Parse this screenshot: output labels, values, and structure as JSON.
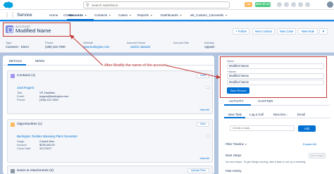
{
  "header": {
    "search_placeholder": "Search Salesforce",
    "badge_1": "Lex",
    "badge_2": "SDFC RT AC",
    "colors": {
      "badge_1": "#ffb75d",
      "badge_2": "#4bca81"
    }
  },
  "nav": {
    "app_name": "Service",
    "items": [
      "Home",
      "Chatter",
      "Accounts",
      "Contacts",
      "Cases",
      "Reports",
      "Dashboards",
      "wk_Custom_Carousels"
    ],
    "active": "Accounts"
  },
  "record": {
    "type_label": "ACCOUNT",
    "name": "Modified Name",
    "buttons": {
      "follow": "+ Follow",
      "new_contact": "New Contact",
      "new_case": "New Case",
      "new_note": "New Note"
    },
    "fields": [
      {
        "label": "Type",
        "value": "Customer - Direct"
      },
      {
        "label": "Phone",
        "value": "(336) 222-7000"
      },
      {
        "label": "Website",
        "value": "www.burlington.com"
      },
      {
        "label": "Account Owner",
        "value": "Sachin Jaiswal"
      },
      {
        "label": "Account Site",
        "value": ""
      },
      {
        "label": "Industry",
        "value": "Apparel"
      }
    ]
  },
  "tabs": {
    "details": "DETAILS",
    "news": "NEWS"
  },
  "contacts_card": {
    "title": "Contacts (1)",
    "new_label": "New",
    "contact_name": "Jack Rogers",
    "rows": [
      {
        "k": "Title:",
        "v": "VP, Facilities"
      },
      {
        "k": "Email:",
        "v": "jrogers@burlington.com"
      },
      {
        "k": "Phone:",
        "v": "(336) 222-7000"
      }
    ],
    "view_all": "View All"
  },
  "opportunities_card": {
    "title": "Opportunities (1)",
    "new_label": "New",
    "opp_name": "Burlington Textiles Weaving Plant Generator",
    "rows": [
      {
        "k": "Stage:",
        "v": "Closed Won"
      },
      {
        "k": "Amount:",
        "v": "$235,000.00"
      },
      {
        "k": "Close Date:",
        "v": "4/17/2017"
      }
    ],
    "view_all": "View All"
  },
  "notes_card": {
    "title": "Notes & Attachments (0)",
    "upload_label": "Upload Files"
  },
  "quick_form": {
    "name_label": "Name",
    "name_value": "Modified Name",
    "name_label_2": "Name",
    "name_value_2": "Modified Name",
    "name_value_3": "Modified Name",
    "save_label": "Save Record"
  },
  "activity": {
    "tab_activity": "ACTIVITY",
    "tab_chatter": "CHATTER",
    "sub_tabs": [
      "New Task",
      "Log a Call",
      "New Eve...",
      "Email"
    ],
    "task_placeholder": "Create a task...",
    "add_label": "Add",
    "filter_label": "Filter Timeline",
    "expand_label": "Expand All",
    "next_steps": "Next Steps",
    "more_steps": "More Steps",
    "no_steps": "No next steps. To get things moving, add a task or set up a meeting.",
    "past_activity": "Past Activity"
  },
  "annotation": {
    "text": "After Modify the name of the account"
  }
}
